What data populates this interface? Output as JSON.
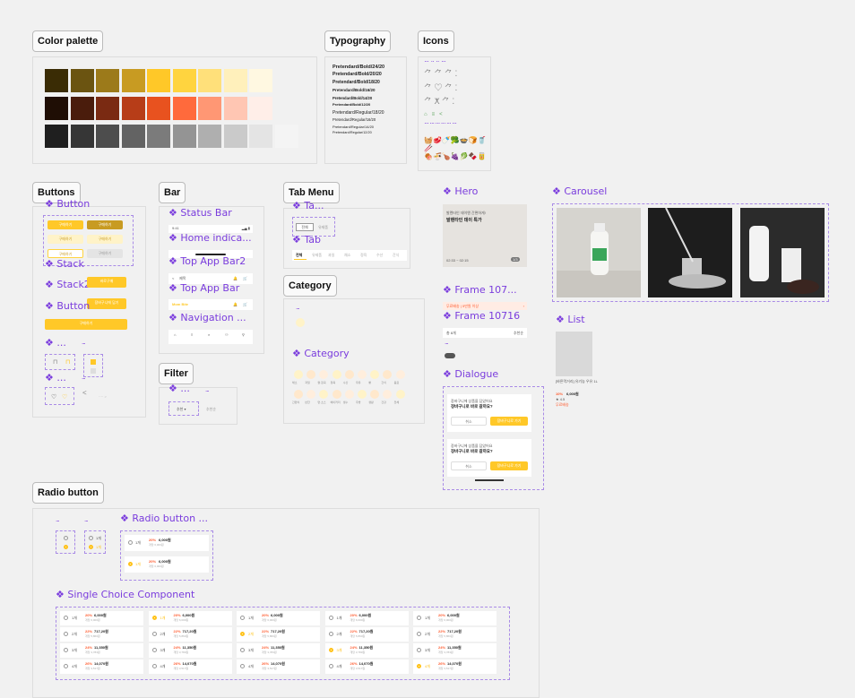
{
  "sections": {
    "color_palette": "Color palette",
    "typography": "Typography",
    "icons": "Icons",
    "buttons": "Buttons",
    "bar": "Bar",
    "tab_menu": "Tab Menu",
    "category": "Category",
    "filter": "Filter",
    "radio_button": "Radio button"
  },
  "components": {
    "button": "❖ Button",
    "stack": "❖ Stack",
    "stack2": "❖ Stack2",
    "button2": "❖ Button",
    "dots1": "❖ ...",
    "dots2": "❖ ...",
    "status_bar": "❖ Status Bar",
    "home_indicator": "❖ Home indica...",
    "top_app_bar2": "❖ Top App Bar2",
    "top_app_bar": "❖ Top App Bar",
    "navigation": "❖ Navigation ...",
    "filter_comp": "❖ ...",
    "tab_a": "❖ Ta...",
    "tab": "❖ Tab",
    "category_comp": "❖ Category",
    "hero": "❖ Hero",
    "frame107": "❖ Frame 107...",
    "frame10716": "❖ Frame 10716",
    "dialogue": "❖ Dialogue",
    "carousel": "❖ Carousel",
    "list": "❖ List",
    "radio_button_comp": "❖ Radio button ...",
    "single_choice": "❖ Single Choice Component"
  },
  "colors": {
    "yellow": [
      "#3a2c05",
      "#6b5411",
      "#9c7a1a",
      "#c89b22",
      "#ffc828",
      "#ffd43f",
      "#ffe07a",
      "#fff0bb",
      "#fff8e1"
    ],
    "orange": [
      "#1f0e05",
      "#4a1c0c",
      "#7a2a12",
      "#b73d18",
      "#e8521f",
      "#ff6a3c",
      "#ff9774",
      "#ffc6b3",
      "#ffeee8"
    ],
    "gray": [
      "#1f1f1f",
      "#363636",
      "#4d4d4d",
      "#636363",
      "#7b7b7b",
      "#949494",
      "#afafaf",
      "#cacaca",
      "#e4e4e4",
      "#f4f4f4"
    ]
  },
  "typography": [
    "Pretendard/Bold/24/20",
    "Pretendard/Bold/20/20",
    "Pretendard/Bold/18/20",
    "Pretendard/Bold/16/20",
    "Pretendard/Bold/14/20",
    "Pretendard/Bold/12/20",
    "Pretendard/Regular/18/20",
    "Pretendard/Regular/16/20",
    "Pretendard/Regular/14/20",
    "Pretendard/Regular/12/20"
  ],
  "buttons": {
    "primary": "구매하기",
    "wide": "장바구니에 담기",
    "stack_left": "장바구니",
    "stack_right": "바로구매"
  },
  "hero": {
    "subtitle": "발렌타인 데이엔 간편하게!",
    "title": "발렌타인 데이 특가",
    "time": "02:33 ~ 02:15",
    "page": "1/3"
  },
  "frame107": {
    "text": "무료배송 | 5만원 이상"
  },
  "frame10716": {
    "sort": "추천순",
    "count": "총 8개"
  },
  "dialogue": {
    "line1": "장바구니에 상품을 담았어요",
    "line2": "장바구니로 바로 갈까요?",
    "cancel": "취소",
    "confirm": "장바구니로 가기"
  },
  "list": {
    "name": "[바른먹거리] 유기농 우유 1L",
    "discount": "10%",
    "price": "6,000원",
    "rating": "★ 4.5",
    "tag": "무료배송"
  },
  "top_app_bar": {
    "title": "제목",
    "brand": "Mom Bite"
  },
  "tabs": [
    "전체",
    "유제품",
    "과일",
    "채소",
    "정육",
    "수산",
    "간식"
  ],
  "categories_row1": [
    "채소",
    "과일",
    "쌀·잡곡",
    "정육",
    "수산",
    "우유",
    "빵",
    "간식",
    "음료"
  ],
  "categories_row2": [
    "간편식",
    "반찬",
    "면·소스",
    "베이커리",
    "생수",
    "주방",
    "생활",
    "건강",
    "전체"
  ],
  "radio_options": [
    {
      "label": "1개",
      "pct": "20%",
      "price": "6,000원",
      "sub": "개당 6,000원"
    },
    {
      "label": "2개",
      "pct": "22%",
      "price": "717,20원",
      "sub": "개당 5,860원"
    },
    {
      "label": "3개",
      "pct": "24%",
      "price": "11,350원",
      "sub": "개당 3,783원"
    },
    {
      "label": "4개",
      "pct": "26%",
      "price": "14,070원",
      "sub": "개당 3,517원"
    }
  ],
  "radio_small": [
    "1개",
    "1개"
  ],
  "radio_sample": [
    {
      "label": "1개",
      "pct": "20%",
      "price": "6,000원",
      "sub": "개당 6,000원"
    },
    {
      "label": "1개",
      "pct": "20%",
      "price": "6,000원",
      "sub": "개당 6,000원"
    }
  ],
  "dots": "..."
}
